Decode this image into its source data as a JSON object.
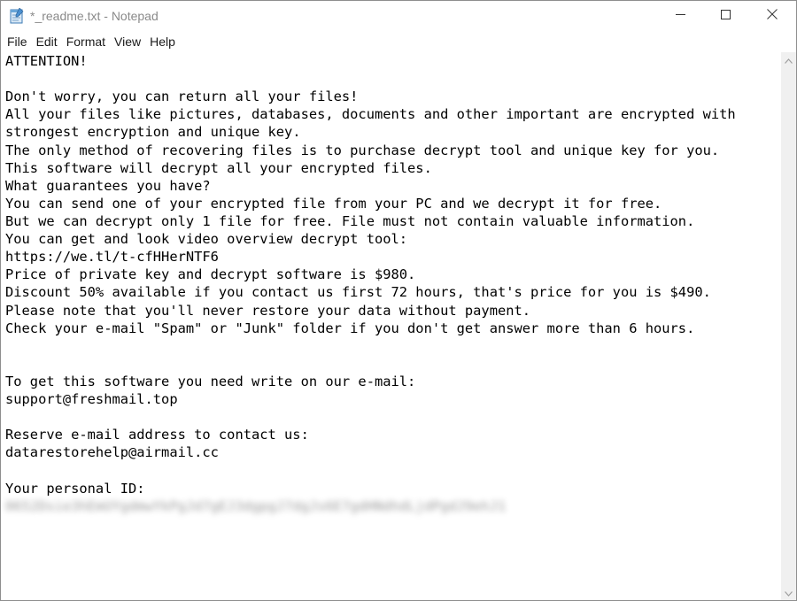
{
  "window": {
    "title": "*_readme.txt - Notepad",
    "icon": "notepad-icon"
  },
  "controls": {
    "minimize_icon": "minimize-icon",
    "maximize_icon": "maximize-icon",
    "close_icon": "close-icon"
  },
  "menu": {
    "items": [
      {
        "label": "File"
      },
      {
        "label": "Edit"
      },
      {
        "label": "Format"
      },
      {
        "label": "View"
      },
      {
        "label": "Help"
      }
    ]
  },
  "document": {
    "lines": [
      "ATTENTION!",
      "",
      "Don't worry, you can return all your files!",
      "All your files like pictures, databases, documents and other important are encrypted with",
      "strongest encryption and unique key.",
      "The only method of recovering files is to purchase decrypt tool and unique key for you.",
      "This software will decrypt all your encrypted files.",
      "What guarantees you have?",
      "You can send one of your encrypted file from your PC and we decrypt it for free.",
      "But we can decrypt only 1 file for free. File must not contain valuable information.",
      "You can get and look video overview decrypt tool:",
      "https://we.tl/t-cfHHerNTF6",
      "Price of private key and decrypt software is $980.",
      "Discount 50% available if you contact us first 72 hours, that's price for you is $490.",
      "Please note that you'll never restore your data without payment.",
      "Check your e-mail \"Spam\" or \"Junk\" folder if you don't get answer more than 6 hours.",
      "",
      "",
      "To get this software you need write on our e-mail:",
      "support@freshmail.top",
      "",
      "Reserve e-mail address to contact us:",
      "datarestorehelp@airmail.cc",
      "",
      "Your personal ID:"
    ],
    "personal_id_redacted": "0652Dsie3hEmUYgdmwYkPgJd7gEJ3dgpgJ7dgJs6E7gdHNdhdLjdPgdJ9ehJ1"
  }
}
